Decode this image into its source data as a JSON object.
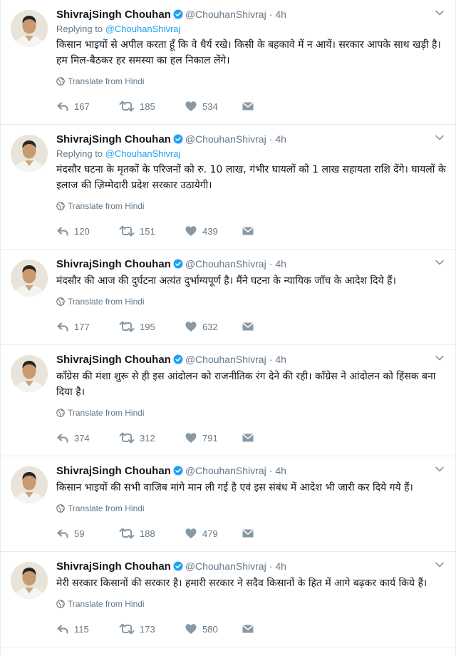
{
  "tweets": [
    {
      "name": "ShivrajSingh Chouhan",
      "handle": "@ChouhanShivraj",
      "time": "4h",
      "replying_prefix": "Replying to",
      "replying_to": "@ChouhanShivraj",
      "text": "किसान भाइयों से अपील करता हूँ कि वे धैर्य रखे। किसी के बहकावे में न आयें। सरकार आपके साथ खड़ी है। हम मिल-बैठकर हर समस्या का हल निकाल लेंगे।",
      "translate": "Translate from Hindi",
      "replies": "167",
      "retweets": "185",
      "likes": "534"
    },
    {
      "name": "ShivrajSingh Chouhan",
      "handle": "@ChouhanShivraj",
      "time": "4h",
      "replying_prefix": "Replying to",
      "replying_to": "@ChouhanShivraj",
      "text": "मंदसौर घटना के मृतकों के परिजनों को रु. 10 लाख, गंभीर घायलों को 1 लाख सहायता राशि देंगे। घायलों के इलाज की ज़िम्मेदारी प्रदेश सरकार उठायेगी।",
      "translate": "Translate from Hindi",
      "replies": "120",
      "retweets": "151",
      "likes": "439"
    },
    {
      "name": "ShivrajSingh Chouhan",
      "handle": "@ChouhanShivraj",
      "time": "4h",
      "text": "मंदसौर की आज की दुर्घटना अत्यंत दुर्भाग्यपूर्ण है। मैंने घटना के न्यायिक जाँच के आदेश दिये हैं।",
      "translate": "Translate from Hindi",
      "replies": "177",
      "retweets": "195",
      "likes": "632"
    },
    {
      "name": "ShivrajSingh Chouhan",
      "handle": "@ChouhanShivraj",
      "time": "4h",
      "text": "कॉंग्रेस की मंशा शुरू से ही इस आंदोलन को राजनीतिक रंग देने की रही। कॉंग्रेस ने आंदोलन को हिंसक बना दिया है।",
      "translate": "Translate from Hindi",
      "replies": "374",
      "retweets": "312",
      "likes": "791"
    },
    {
      "name": "ShivrajSingh Chouhan",
      "handle": "@ChouhanShivraj",
      "time": "4h",
      "text": "किसान भाइयों की सभी वाजिब मांगे मान ली गई है एवं इस संबंध में आदेश भी जारी कर दिये गये हैं।",
      "translate": "Translate from Hindi",
      "replies": "59",
      "retweets": "188",
      "likes": "479"
    },
    {
      "name": "ShivrajSingh Chouhan",
      "handle": "@ChouhanShivraj",
      "time": "4h",
      "text": "मेरी सरकार किसानों की सरकार है। हमारी सरकार ने सदैव किसानों के हित में आगे बढ़कर कार्य किये हैं।",
      "translate": "Translate from Hindi",
      "replies": "115",
      "retweets": "173",
      "likes": "580"
    }
  ],
  "icons": {
    "reply": "reply-icon",
    "retweet": "retweet-icon",
    "like": "heart-icon",
    "dm": "envelope-icon",
    "verified": "verified-badge-icon",
    "caret": "chevron-down-icon",
    "globe": "globe-icon"
  },
  "colors": {
    "accent": "#1da1f2",
    "muted": "#657786",
    "text": "#14171a",
    "divider": "#e6ecf0"
  }
}
